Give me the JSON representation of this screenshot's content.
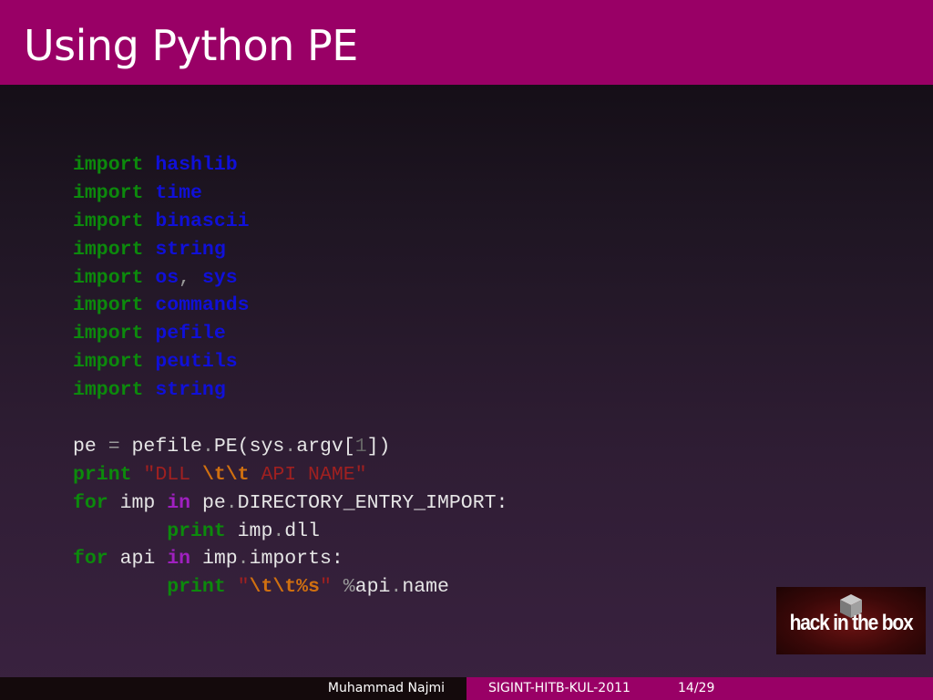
{
  "slide": {
    "title": "Using Python PE"
  },
  "code": {
    "lines": [
      [
        {
          "c": "k",
          "t": "import"
        },
        {
          "c": "n",
          "t": " "
        },
        {
          "c": "m",
          "t": "hashlib"
        }
      ],
      [
        {
          "c": "k",
          "t": "import"
        },
        {
          "c": "n",
          "t": " "
        },
        {
          "c": "m",
          "t": "time"
        }
      ],
      [
        {
          "c": "k",
          "t": "import"
        },
        {
          "c": "n",
          "t": " "
        },
        {
          "c": "m",
          "t": "binascii"
        }
      ],
      [
        {
          "c": "k",
          "t": "import"
        },
        {
          "c": "n",
          "t": " "
        },
        {
          "c": "m",
          "t": "string"
        }
      ],
      [
        {
          "c": "k",
          "t": "import"
        },
        {
          "c": "n",
          "t": " "
        },
        {
          "c": "m",
          "t": "os"
        },
        {
          "c": "p",
          "t": ", "
        },
        {
          "c": "m",
          "t": "sys"
        }
      ],
      [
        {
          "c": "k",
          "t": "import"
        },
        {
          "c": "n",
          "t": " "
        },
        {
          "c": "m",
          "t": "commands"
        }
      ],
      [
        {
          "c": "k",
          "t": "import"
        },
        {
          "c": "n",
          "t": " "
        },
        {
          "c": "m",
          "t": "pefile"
        }
      ],
      [
        {
          "c": "k",
          "t": "import"
        },
        {
          "c": "n",
          "t": " "
        },
        {
          "c": "m",
          "t": "peutils"
        }
      ],
      [
        {
          "c": "k",
          "t": "import"
        },
        {
          "c": "n",
          "t": " "
        },
        {
          "c": "m",
          "t": "string"
        }
      ],
      [],
      [
        {
          "c": "n",
          "t": "pe "
        },
        {
          "c": "p",
          "t": "="
        },
        {
          "c": "n",
          "t": " pefile"
        },
        {
          "c": "p",
          "t": "."
        },
        {
          "c": "n",
          "t": "PE(sys"
        },
        {
          "c": "p",
          "t": "."
        },
        {
          "c": "n",
          "t": "argv["
        },
        {
          "c": "num",
          "t": "1"
        },
        {
          "c": "n",
          "t": "])"
        }
      ],
      [
        {
          "c": "k",
          "t": "print"
        },
        {
          "c": "n",
          "t": " "
        },
        {
          "c": "s",
          "t": "\"DLL "
        },
        {
          "c": "e",
          "t": "\\t\\t"
        },
        {
          "c": "s",
          "t": " API NAME\""
        }
      ],
      [
        {
          "c": "k",
          "t": "for"
        },
        {
          "c": "n",
          "t": " imp "
        },
        {
          "c": "o",
          "t": "in"
        },
        {
          "c": "n",
          "t": " pe"
        },
        {
          "c": "p",
          "t": "."
        },
        {
          "c": "n",
          "t": "DIRECTORY_ENTRY_IMPORT:"
        }
      ],
      [
        {
          "c": "n",
          "t": "        "
        },
        {
          "c": "k",
          "t": "print"
        },
        {
          "c": "n",
          "t": " imp"
        },
        {
          "c": "p",
          "t": "."
        },
        {
          "c": "n",
          "t": "dll"
        }
      ],
      [
        {
          "c": "k",
          "t": "for"
        },
        {
          "c": "n",
          "t": " api "
        },
        {
          "c": "o",
          "t": "in"
        },
        {
          "c": "n",
          "t": " imp"
        },
        {
          "c": "p",
          "t": "."
        },
        {
          "c": "n",
          "t": "imports:"
        }
      ],
      [
        {
          "c": "n",
          "t": "        "
        },
        {
          "c": "k",
          "t": "print"
        },
        {
          "c": "n",
          "t": " "
        },
        {
          "c": "s",
          "t": "\""
        },
        {
          "c": "e",
          "t": "\\t\\t%s"
        },
        {
          "c": "s",
          "t": "\""
        },
        {
          "c": "n",
          "t": " "
        },
        {
          "c": "p",
          "t": "%"
        },
        {
          "c": "n",
          "t": "api"
        },
        {
          "c": "p",
          "t": "."
        },
        {
          "c": "n",
          "t": "name"
        }
      ]
    ]
  },
  "logo": {
    "text": "hack in the box"
  },
  "footer": {
    "author": "Muhammad Najmi",
    "event": "SIGINT-HITB-KUL-2011",
    "page": "14/29"
  },
  "colors": {
    "accent": "#990066",
    "keyword": "#0c8a0c",
    "module": "#1010d8",
    "string": "#a02020",
    "escape": "#d07010",
    "operator": "#a020c0"
  }
}
